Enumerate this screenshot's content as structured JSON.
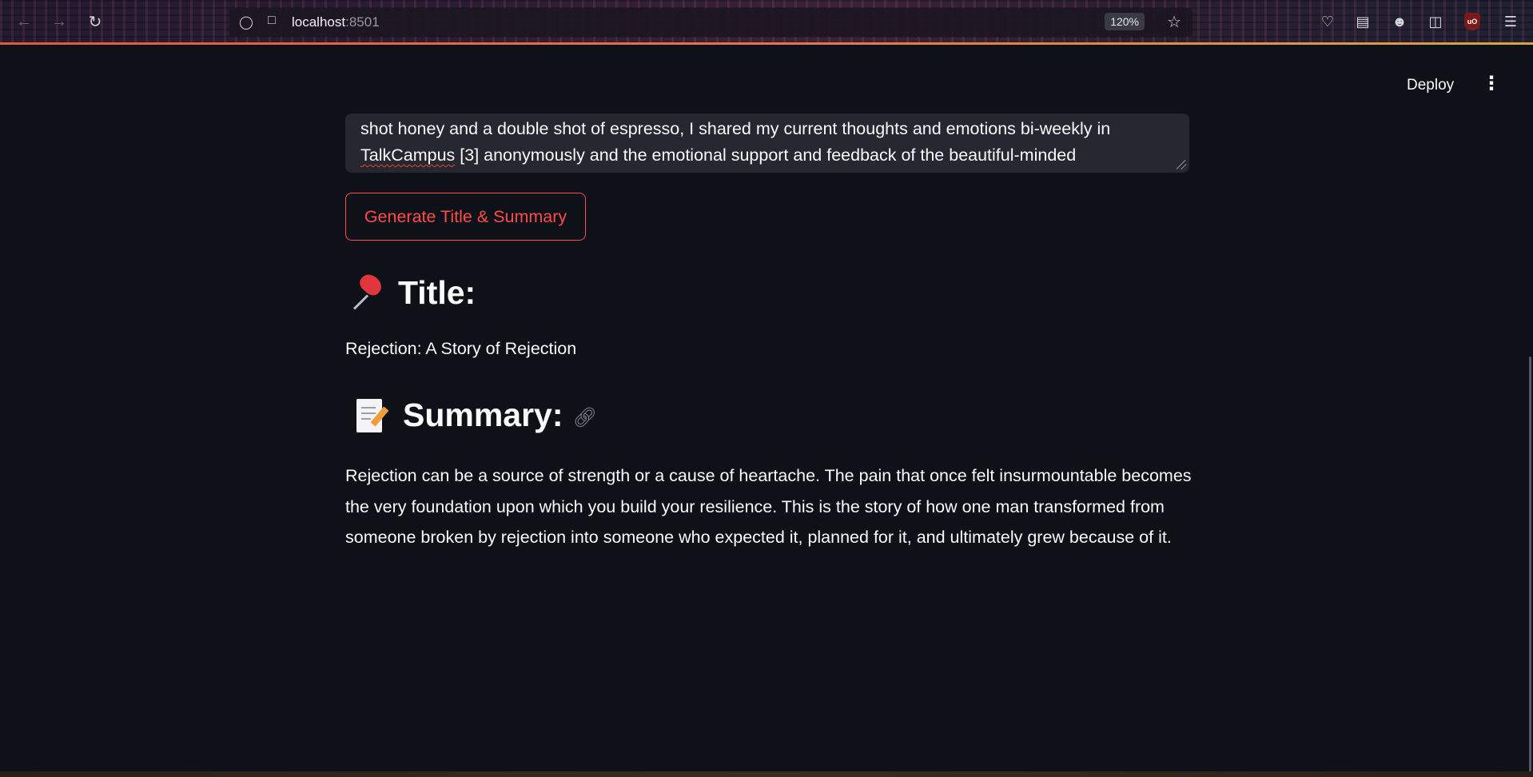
{
  "browser": {
    "url_host": "localhost",
    "url_port": ":8501",
    "zoom": "120%"
  },
  "app_header": {
    "deploy_label": "Deploy"
  },
  "textarea": {
    "line1": "shot honey and a double shot of espresso, I shared my current thoughts and emotions bi-weekly in",
    "line2_misspelled": "TalkCampus",
    "line2_rest": " [3] anonymously and the emotional support and feedback of the beautiful-minded"
  },
  "generate_button": {
    "label": "Generate Title & Summary"
  },
  "title_section": {
    "heading": "Title:",
    "value": "Rejection: A Story of Rejection"
  },
  "summary_section": {
    "heading": "Summary:",
    "text": "Rejection can be a source of strength or a cause of heartache. The pain that once felt insurmountable becomes the very foundation upon which you build your resilience. This is the story of how one man transformed from someone broken by rejection into someone who expected it, planned for it, and ultimately grew because of it."
  },
  "colors": {
    "background": "#0e1117",
    "primary": "#ff4b4b",
    "input_bg": "#262730",
    "text": "#fafafa"
  }
}
